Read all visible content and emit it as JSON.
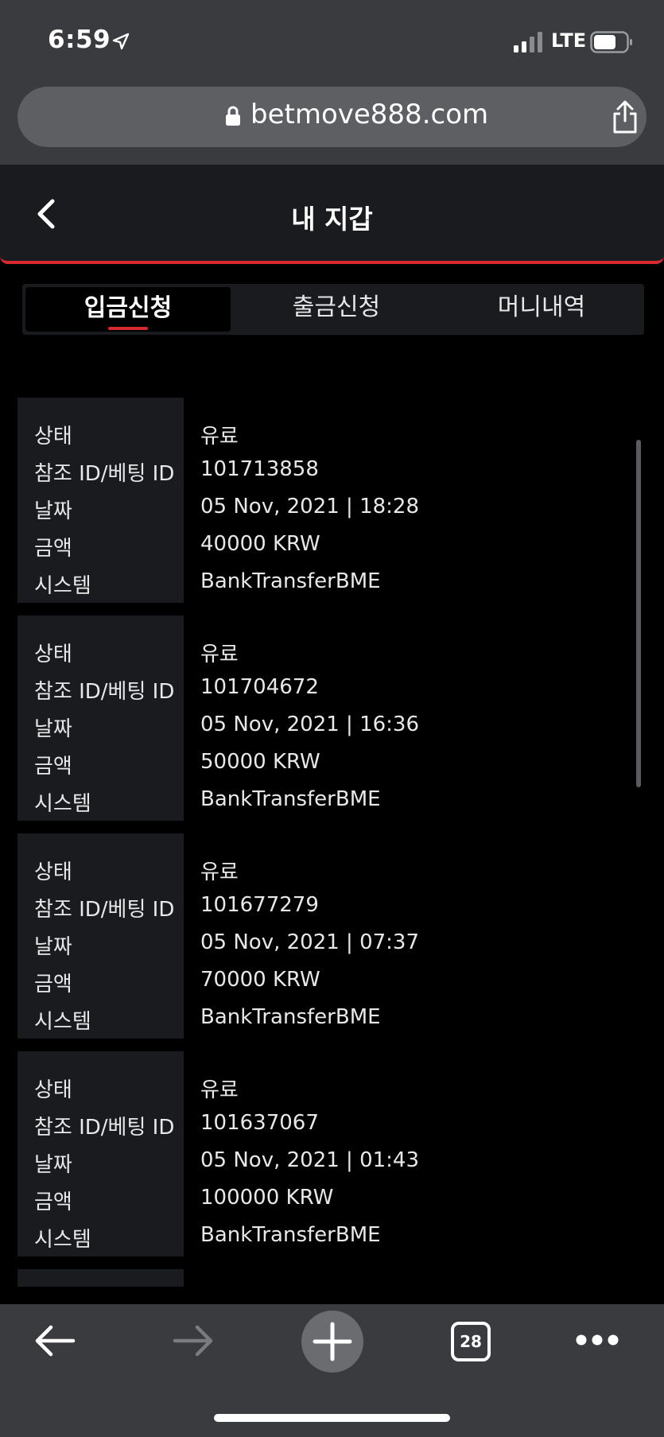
{
  "status_bar": {
    "time": "6:59",
    "network": "LTE",
    "icons": [
      "location-arrow-icon",
      "cellular-signal-icon",
      "battery-icon"
    ]
  },
  "browser": {
    "url": "betmove888.com",
    "icons": [
      "lock-icon",
      "share-icon"
    ]
  },
  "header": {
    "title": "내 지갑",
    "back_icon": "chevron-left-icon"
  },
  "tabs": [
    {
      "label": "입금신청",
      "active": true
    },
    {
      "label": "출금신청",
      "active": false
    },
    {
      "label": "머니내역",
      "active": false
    }
  ],
  "labels": {
    "status": "상태",
    "ref_id": "참조 ID/베팅 ID",
    "date": "날짜",
    "amount": "금액",
    "system": "시스템"
  },
  "transactions": [
    {
      "status": "유료",
      "ref_id": "101713858",
      "date": "05 Nov, 2021 | 18:28",
      "amount": "40000 KRW",
      "system": "BankTransferBME"
    },
    {
      "status": "유료",
      "ref_id": "101704672",
      "date": "05 Nov, 2021 | 16:36",
      "amount": "50000 KRW",
      "system": "BankTransferBME"
    },
    {
      "status": "유료",
      "ref_id": "101677279",
      "date": "05 Nov, 2021 | 07:37",
      "amount": "70000 KRW",
      "system": "BankTransferBME"
    },
    {
      "status": "유료",
      "ref_id": "101637067",
      "date": "05 Nov, 2021 | 01:43",
      "amount": "100000 KRW",
      "system": "BankTransferBME"
    }
  ],
  "toolbar": {
    "tab_count": "28",
    "icons": [
      "back-arrow-icon",
      "forward-arrow-icon",
      "plus-icon",
      "tabs-icon",
      "more-icon"
    ]
  },
  "colors": {
    "accent": "#d8292f",
    "background": "#000000",
    "panel": "#1a1b1f",
    "browser_chrome": "#3a3b3f"
  }
}
